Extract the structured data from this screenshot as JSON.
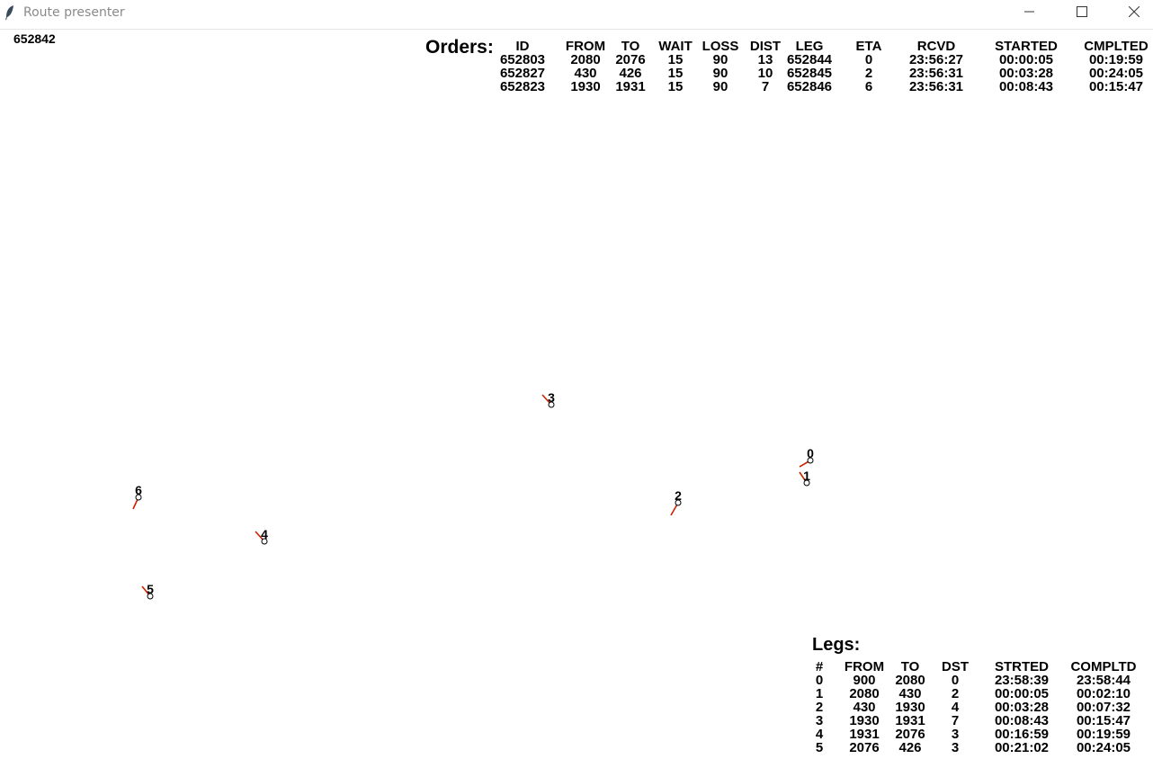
{
  "window": {
    "title": "Route presenter",
    "icon": "feather-icon",
    "controls": [
      "minimize-icon",
      "maximize-icon",
      "close-icon"
    ]
  },
  "current_id": "652842",
  "orders": {
    "heading": "Orders:",
    "columns": [
      "ID",
      "FROM",
      "TO",
      "WAIT",
      "LOSS",
      "DIST",
      "LEG",
      "ETA",
      "RCVD",
      "STARTED",
      "CMPLTED"
    ],
    "rows": [
      [
        "652803",
        "2080",
        "2076",
        "15",
        "90",
        "13",
        "652844",
        "0",
        "23:56:27",
        "00:00:05",
        "00:19:59"
      ],
      [
        "652827",
        "430",
        "426",
        "15",
        "90",
        "10",
        "652845",
        "2",
        "23:56:31",
        "00:03:28",
        "00:24:05"
      ],
      [
        "652823",
        "1930",
        "1931",
        "15",
        "90",
        "7",
        "652846",
        "6",
        "23:56:31",
        "00:08:43",
        "00:15:47"
      ]
    ]
  },
  "legs": {
    "heading": "Legs:",
    "columns": [
      "#",
      "FROM",
      "TO",
      "DST",
      "STRTED",
      "COMPLTD"
    ],
    "rows": [
      [
        "0",
        "900",
        "2080",
        "0",
        "23:58:39",
        "23:58:44"
      ],
      [
        "1",
        "2080",
        "430",
        "2",
        "00:00:05",
        "00:02:10"
      ],
      [
        "2",
        "430",
        "1930",
        "4",
        "00:03:28",
        "00:07:32"
      ],
      [
        "3",
        "1930",
        "1931",
        "7",
        "00:08:43",
        "00:15:47"
      ],
      [
        "4",
        "1931",
        "2076",
        "3",
        "00:16:59",
        "00:19:59"
      ],
      [
        "5",
        "2076",
        "426",
        "3",
        "00:21:02",
        "00:24:05"
      ]
    ]
  },
  "map_nodes": [
    {
      "label": "0"
    },
    {
      "label": "1"
    },
    {
      "label": "2"
    },
    {
      "label": "3"
    },
    {
      "label": "4"
    },
    {
      "label": "5"
    },
    {
      "label": "6"
    }
  ],
  "colors": {
    "heading_line": "#cc2200",
    "text": "#000000",
    "title_text": "#8a8a8a"
  }
}
